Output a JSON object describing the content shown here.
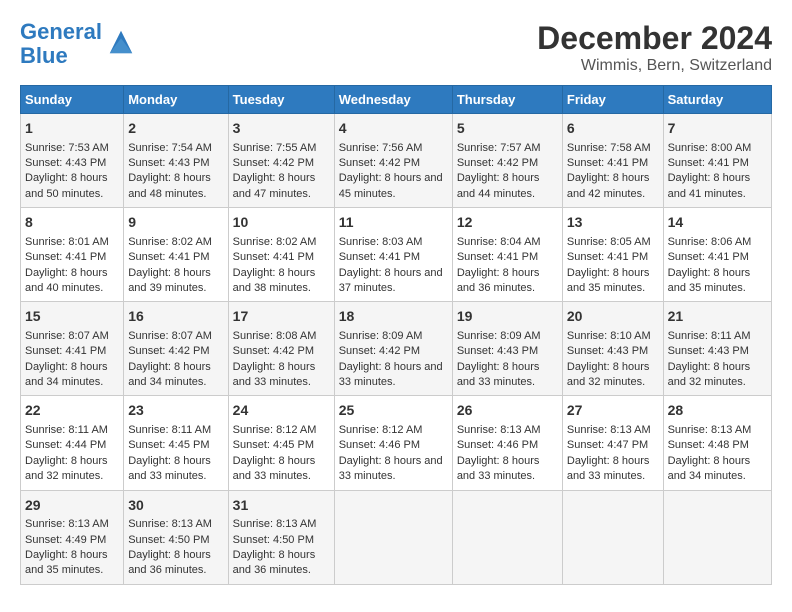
{
  "logo": {
    "line1": "General",
    "line2": "Blue"
  },
  "title": "December 2024",
  "subtitle": "Wimmis, Bern, Switzerland",
  "weekdays": [
    "Sunday",
    "Monday",
    "Tuesday",
    "Wednesday",
    "Thursday",
    "Friday",
    "Saturday"
  ],
  "weeks": [
    [
      {
        "day": "1",
        "sunrise": "7:53 AM",
        "sunset": "4:43 PM",
        "daylight": "8 hours and 50 minutes."
      },
      {
        "day": "2",
        "sunrise": "7:54 AM",
        "sunset": "4:43 PM",
        "daylight": "8 hours and 48 minutes."
      },
      {
        "day": "3",
        "sunrise": "7:55 AM",
        "sunset": "4:42 PM",
        "daylight": "8 hours and 47 minutes."
      },
      {
        "day": "4",
        "sunrise": "7:56 AM",
        "sunset": "4:42 PM",
        "daylight": "8 hours and 45 minutes."
      },
      {
        "day": "5",
        "sunrise": "7:57 AM",
        "sunset": "4:42 PM",
        "daylight": "8 hours and 44 minutes."
      },
      {
        "day": "6",
        "sunrise": "7:58 AM",
        "sunset": "4:41 PM",
        "daylight": "8 hours and 42 minutes."
      },
      {
        "day": "7",
        "sunrise": "8:00 AM",
        "sunset": "4:41 PM",
        "daylight": "8 hours and 41 minutes."
      }
    ],
    [
      {
        "day": "8",
        "sunrise": "8:01 AM",
        "sunset": "4:41 PM",
        "daylight": "8 hours and 40 minutes."
      },
      {
        "day": "9",
        "sunrise": "8:02 AM",
        "sunset": "4:41 PM",
        "daylight": "8 hours and 39 minutes."
      },
      {
        "day": "10",
        "sunrise": "8:02 AM",
        "sunset": "4:41 PM",
        "daylight": "8 hours and 38 minutes."
      },
      {
        "day": "11",
        "sunrise": "8:03 AM",
        "sunset": "4:41 PM",
        "daylight": "8 hours and 37 minutes."
      },
      {
        "day": "12",
        "sunrise": "8:04 AM",
        "sunset": "4:41 PM",
        "daylight": "8 hours and 36 minutes."
      },
      {
        "day": "13",
        "sunrise": "8:05 AM",
        "sunset": "4:41 PM",
        "daylight": "8 hours and 35 minutes."
      },
      {
        "day": "14",
        "sunrise": "8:06 AM",
        "sunset": "4:41 PM",
        "daylight": "8 hours and 35 minutes."
      }
    ],
    [
      {
        "day": "15",
        "sunrise": "8:07 AM",
        "sunset": "4:41 PM",
        "daylight": "8 hours and 34 minutes."
      },
      {
        "day": "16",
        "sunrise": "8:07 AM",
        "sunset": "4:42 PM",
        "daylight": "8 hours and 34 minutes."
      },
      {
        "day": "17",
        "sunrise": "8:08 AM",
        "sunset": "4:42 PM",
        "daylight": "8 hours and 33 minutes."
      },
      {
        "day": "18",
        "sunrise": "8:09 AM",
        "sunset": "4:42 PM",
        "daylight": "8 hours and 33 minutes."
      },
      {
        "day": "19",
        "sunrise": "8:09 AM",
        "sunset": "4:43 PM",
        "daylight": "8 hours and 33 minutes."
      },
      {
        "day": "20",
        "sunrise": "8:10 AM",
        "sunset": "4:43 PM",
        "daylight": "8 hours and 32 minutes."
      },
      {
        "day": "21",
        "sunrise": "8:11 AM",
        "sunset": "4:43 PM",
        "daylight": "8 hours and 32 minutes."
      }
    ],
    [
      {
        "day": "22",
        "sunrise": "8:11 AM",
        "sunset": "4:44 PM",
        "daylight": "8 hours and 32 minutes."
      },
      {
        "day": "23",
        "sunrise": "8:11 AM",
        "sunset": "4:45 PM",
        "daylight": "8 hours and 33 minutes."
      },
      {
        "day": "24",
        "sunrise": "8:12 AM",
        "sunset": "4:45 PM",
        "daylight": "8 hours and 33 minutes."
      },
      {
        "day": "25",
        "sunrise": "8:12 AM",
        "sunset": "4:46 PM",
        "daylight": "8 hours and 33 minutes."
      },
      {
        "day": "26",
        "sunrise": "8:13 AM",
        "sunset": "4:46 PM",
        "daylight": "8 hours and 33 minutes."
      },
      {
        "day": "27",
        "sunrise": "8:13 AM",
        "sunset": "4:47 PM",
        "daylight": "8 hours and 33 minutes."
      },
      {
        "day": "28",
        "sunrise": "8:13 AM",
        "sunset": "4:48 PM",
        "daylight": "8 hours and 34 minutes."
      }
    ],
    [
      {
        "day": "29",
        "sunrise": "8:13 AM",
        "sunset": "4:49 PM",
        "daylight": "8 hours and 35 minutes."
      },
      {
        "day": "30",
        "sunrise": "8:13 AM",
        "sunset": "4:50 PM",
        "daylight": "8 hours and 36 minutes."
      },
      {
        "day": "31",
        "sunrise": "8:13 AM",
        "sunset": "4:50 PM",
        "daylight": "8 hours and 36 minutes."
      },
      null,
      null,
      null,
      null
    ]
  ],
  "labels": {
    "sunrise": "Sunrise: ",
    "sunset": "Sunset: ",
    "daylight": "Daylight: "
  }
}
